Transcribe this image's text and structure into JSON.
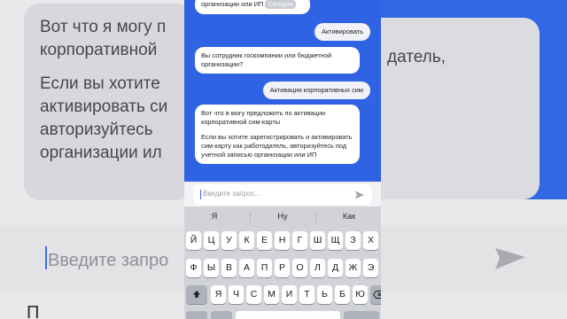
{
  "background": {
    "card_text_1": "Вот что я могу п",
    "card_text_2": "корпоративной",
    "card_text_3": "Если вы хотите",
    "card_text_4": "активировать си",
    "card_text_5": "авторизуйтесь",
    "card_text_6": "организации ил",
    "right_text_1": "датель,",
    "input_placeholder": "Введите запро",
    "bottom_text": "П"
  },
  "chat": {
    "bubble_1_text": "организации или ИП",
    "bubble_1_chip": "Сегодня",
    "bubble_2_text": "Активировать",
    "bubble_3_text": "Вы сотрудник госкомпании или бюджетной организации?",
    "bubble_4_text": "Активация корпоративных сим",
    "bubble_5_para1": "Вот что я могу предложить по активации корпоративной сим-карты",
    "bubble_5_para2": "Если вы хотите зарегистрировать и активировать сим-карту как работодатель, авторизуйтесь под учетной записью организации или ИП"
  },
  "composer": {
    "placeholder": "Введите запрос..."
  },
  "keyboard": {
    "suggestions": [
      "Я",
      "Ну",
      "Как"
    ],
    "row1": [
      "Й",
      "Ц",
      "У",
      "К",
      "Е",
      "Н",
      "Г",
      "Ш",
      "Щ",
      "З",
      "Х"
    ],
    "row2": [
      "Ф",
      "Ы",
      "В",
      "А",
      "П",
      "Р",
      "О",
      "Л",
      "Д",
      "Ж",
      "Э"
    ],
    "row3": [
      "Я",
      "Ч",
      "С",
      "М",
      "И",
      "Т",
      "Ь",
      "Б",
      "Ю"
    ]
  },
  "colors": {
    "chat_background": "#2f63e3",
    "keyboard_background": "#d1d3d9"
  }
}
